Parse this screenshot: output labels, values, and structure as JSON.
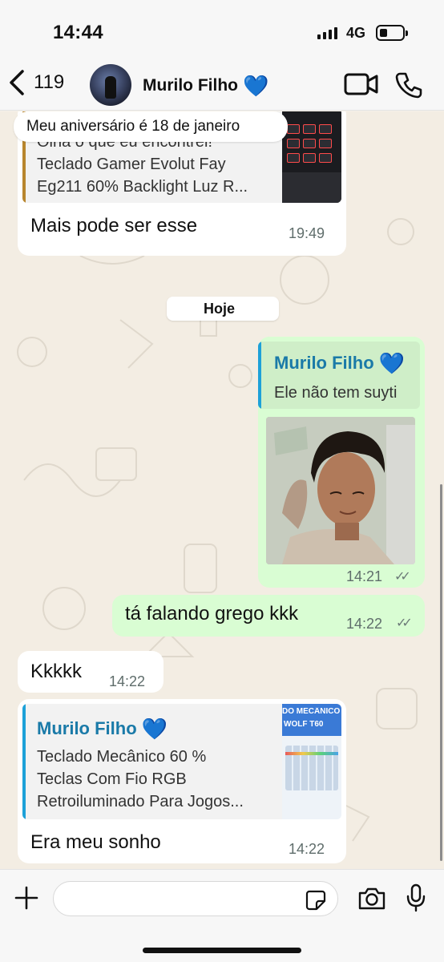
{
  "status_bar": {
    "time": "14:44",
    "network": "4G"
  },
  "header": {
    "back_count": "119",
    "contact_name": "Murilo Filho",
    "contact_emoji": "💙",
    "icons": [
      "chevron-left-icon",
      "video-call-icon",
      "phone-icon"
    ]
  },
  "messages": {
    "pinned_banner": "Meu aniversário é 18 de janeiro",
    "m1": {
      "link_heading": "Olha o que eu encontrei!",
      "link_line1": "Teclado Gamer Evolut Fay",
      "link_line2": "Eg211 60% Backlight Luz R...",
      "text": "Mais pode ser esse",
      "time": "19:49"
    },
    "date_separator": "Hoje",
    "m2": {
      "reply_author": "Murilo Filho",
      "reply_emoji": "💙",
      "reply_text": "Ele não tem suyti",
      "time": "14:21"
    },
    "m3": {
      "text": "tá falando grego kkk",
      "time": "14:22"
    },
    "m4": {
      "text": "Kkkkk",
      "time": "14:22"
    },
    "m5": {
      "link_author": "Murilo Filho",
      "link_emoji": "💙",
      "link_line1": "Teclado Mecânico 60 %",
      "link_line2": "Teclas Com Fio RGB",
      "link_line3": "Retroiluminado Para Jogos...",
      "thumb_text1": "DO MECÂNICO",
      "thumb_text2": "WOLF T60",
      "text": "Era meu sonho",
      "time": "14:22"
    }
  },
  "footer": {
    "message_placeholder": "",
    "icons": [
      "plus-icon",
      "sticker-icon",
      "camera-icon",
      "microphone-icon"
    ]
  },
  "colors": {
    "chat_background": "#f3ede3",
    "incoming_bubble": "#ffffff",
    "outgoing_bubble": "#d9fdd3",
    "reply_accent": "#1da1d8",
    "link_accent": "#b8862e",
    "author_name": "#1a7aa8"
  }
}
